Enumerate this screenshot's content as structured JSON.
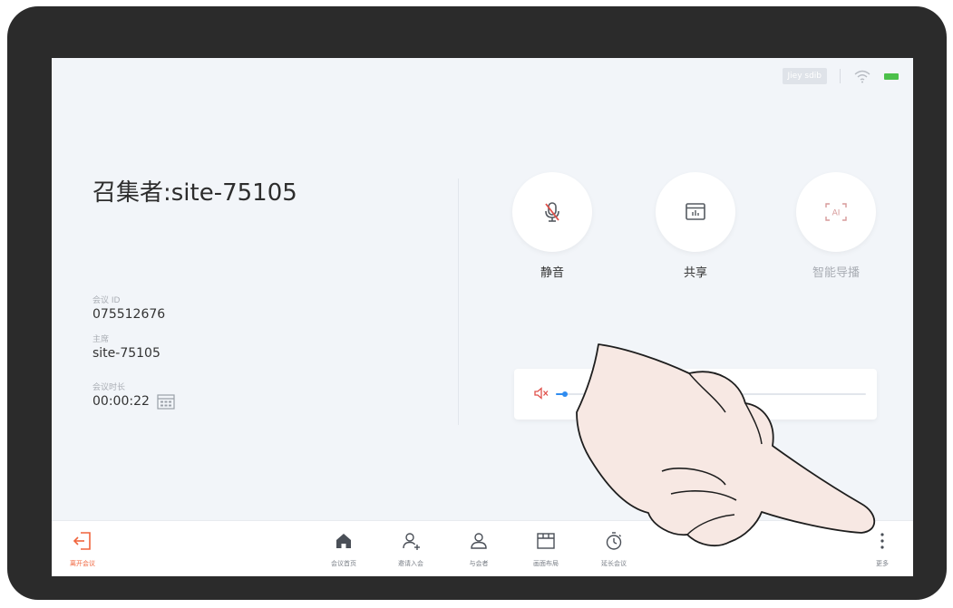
{
  "status": {
    "chip_text": "Jiey sdib"
  },
  "meeting": {
    "convener": "召集者:site-75105",
    "id_label": "会议 ID",
    "id_value": "075512676",
    "chair_label": "主席",
    "chair_value": "site-75105",
    "duration_label": "会议时长",
    "duration_value": "00:00:22"
  },
  "controls": [
    {
      "label": "静音",
      "icon": "microphone-muted-icon",
      "enabled": true
    },
    {
      "label": "共享",
      "icon": "share-screen-icon",
      "enabled": true
    },
    {
      "label": "智能导播",
      "icon": "smart-director-icon",
      "enabled": false
    }
  ],
  "volume": {
    "icon": "speaker-muted-icon",
    "level": 0.03
  },
  "toolbar": {
    "leave": "离开会议",
    "home": "会议首页",
    "invite": "邀请入会",
    "participants": "与会者",
    "layout": "画面布局",
    "extend": "延长会议",
    "more": "更多"
  },
  "colors": {
    "accent": "#2f8cf0",
    "leave": "#f0643c",
    "mic_muted": "#e0504a",
    "battery": "#4cc04a"
  }
}
